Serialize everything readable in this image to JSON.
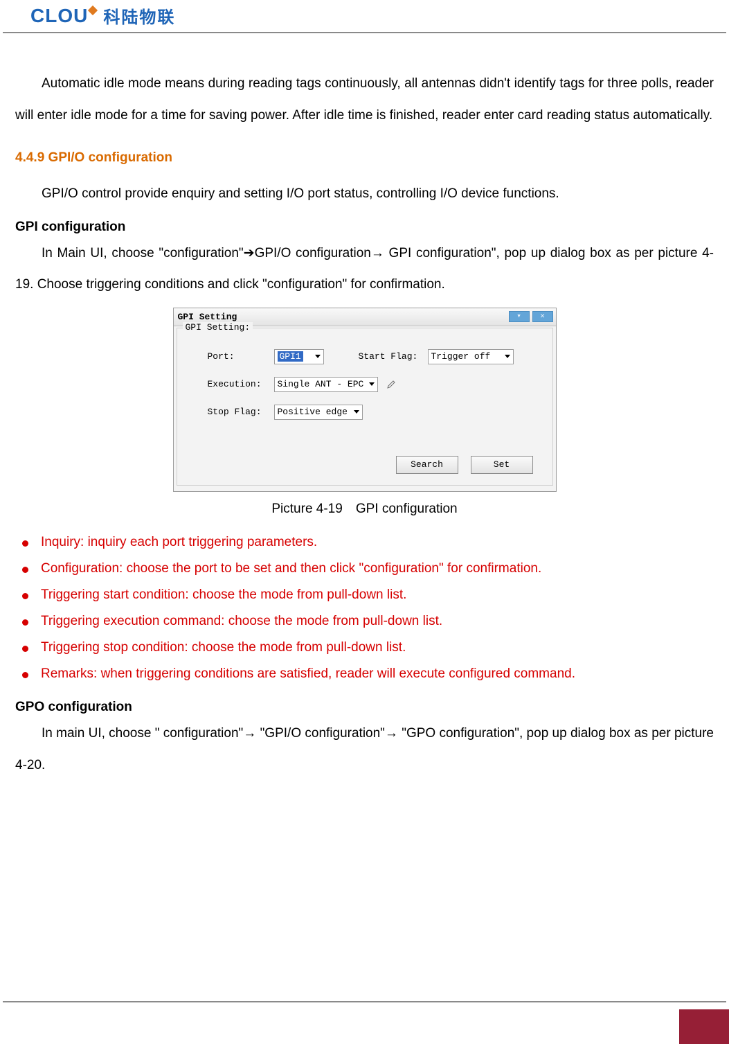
{
  "header": {
    "logo_en": "CLOU",
    "logo_cn": "科陆物联"
  },
  "intro_para": "Automatic idle mode means during reading tags continuously, all antennas didn't identify tags for three polls, reader will enter idle mode for a time for saving power. After idle time is finished, reader enter card reading status automatically.",
  "section": {
    "num_title": "4.4.9 GPI/O configuration",
    "para1": "GPI/O control provide enquiry and setting I/O port status, controlling I/O device functions.",
    "gpi_heading": "GPI configuration",
    "gpi_para_a": "In Main UI, choose \"configuration\"",
    "gpi_para_b": "GPI/O configuration",
    "gpi_para_c": " GPI configuration\", pop up dialog box as per picture 4-19. Choose triggering conditions and click \"configuration\" for confirmation.",
    "arrow": "➔",
    "arrow2": "→"
  },
  "dialog": {
    "title": "GPI Setting",
    "group_legend": "GPI Setting:",
    "labels": {
      "port": "Port:",
      "start_flag": "Start Flag:",
      "execution": "Execution:",
      "stop_flag": "Stop Flag:"
    },
    "values": {
      "port": "GPI1",
      "start_flag": "Trigger off",
      "execution": "Single ANT - EPC",
      "stop_flag": "Positive edge"
    },
    "buttons": {
      "search": "Search",
      "set": "Set"
    }
  },
  "caption": "Picture 4-19 GPI configuration",
  "bullets": [
    "Inquiry: inquiry each port triggering parameters.",
    "Configuration: choose the port to be set and then click \"configuration\" for confirmation.",
    "Triggering start condition: choose the mode from pull-down list.",
    "Triggering execution command: choose the mode from pull-down list.",
    "Triggering stop condition: choose the mode from pull-down list.",
    "Remarks: when triggering conditions are satisfied, reader will execute configured command."
  ],
  "gpo": {
    "heading": "GPO configuration",
    "para_a": "In main UI, choose \" configuration\"",
    "para_b": " \"GPI/O configuration\"",
    "para_c": " \"GPO configuration\", pop up dialog box as per picture 4-20."
  }
}
